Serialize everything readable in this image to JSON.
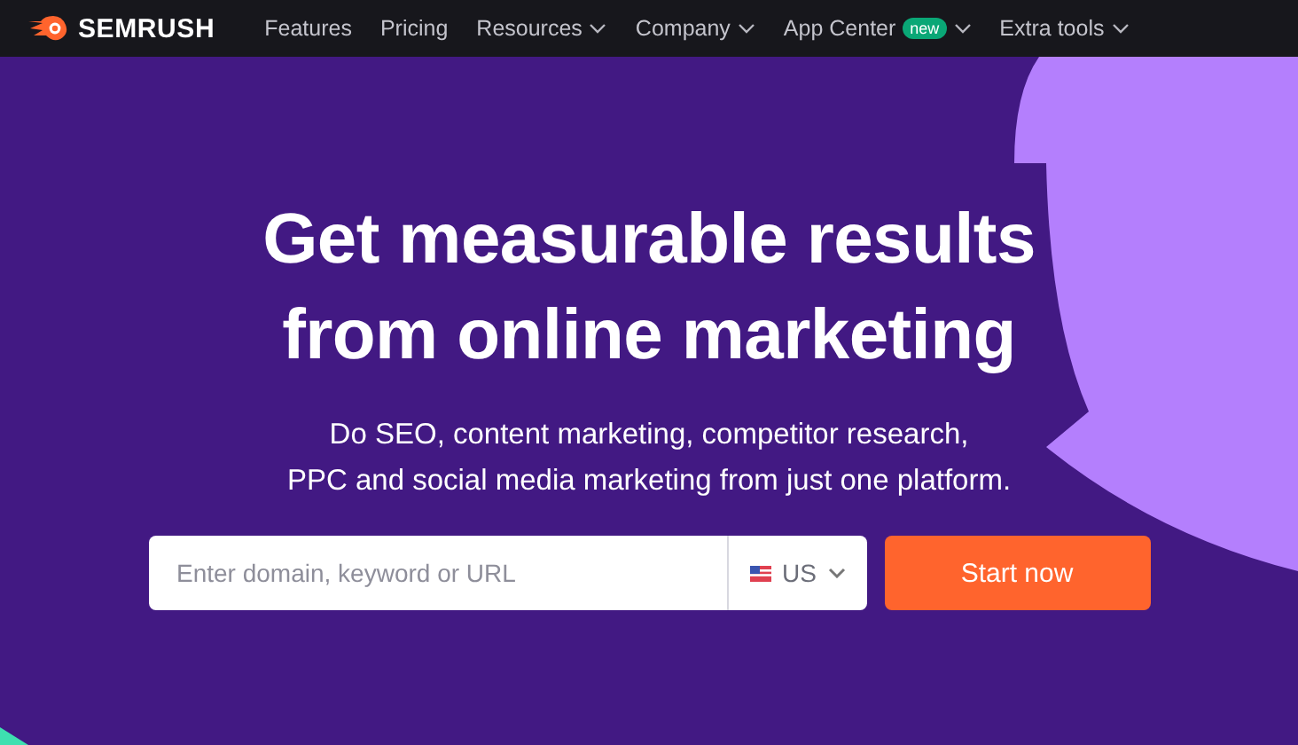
{
  "logo": {
    "text": "SEMRUSH"
  },
  "nav": [
    {
      "label": "Features",
      "dropdown": false
    },
    {
      "label": "Pricing",
      "dropdown": false
    },
    {
      "label": "Resources",
      "dropdown": true
    },
    {
      "label": "Company",
      "dropdown": true
    },
    {
      "label": "App Center",
      "dropdown": true,
      "badge": "new"
    },
    {
      "label": "Extra tools",
      "dropdown": true
    }
  ],
  "hero": {
    "title_lines": [
      "Get measurable results",
      "from online marketing"
    ],
    "subtitle_lines": [
      "Do SEO, content marketing, competitor research,",
      "PPC and social media marketing from just one platform."
    ],
    "search": {
      "placeholder": "Enter domain, keyword or URL"
    },
    "country": "US",
    "button": "Start now"
  }
}
